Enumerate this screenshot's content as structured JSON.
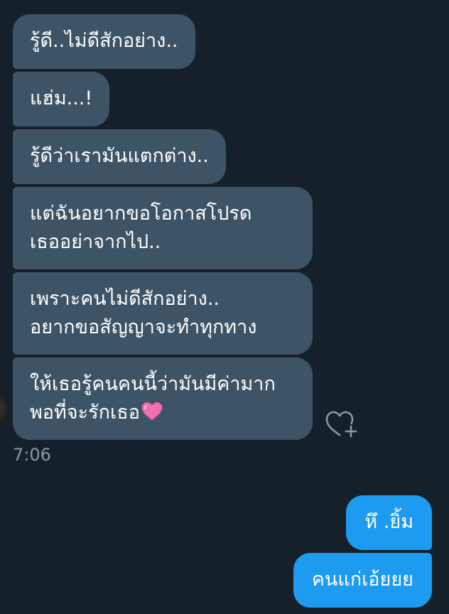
{
  "conversation": {
    "incoming_messages": [
      {
        "lines": [
          "รู้ดี..ไม่ดีสักอย่าง.."
        ]
      },
      {
        "lines": [
          "แฮ่ม...!"
        ]
      },
      {
        "lines": [
          "รู้ดีว่าเรามันแตกต่าง.."
        ]
      },
      {
        "lines": [
          "แต่ฉันอยากขอโอกาสโปรด",
          "เธออย่าจากไป.."
        ]
      },
      {
        "lines": [
          "เพราะคนไม่ดีสักอย่าง..",
          "อยากขอสัญญาจะทำทุกทาง"
        ]
      },
      {
        "lines": [
          "ให้เธอรู้คนคนนี้ว่ามันมีค่ามาก",
          "พอที่จะรักเธอ"
        ],
        "trailing_emoji": "pink-heart"
      }
    ],
    "timestamp": "7:06",
    "outgoing_messages": [
      {
        "lines": [
          "หึ .ยิ้ม"
        ]
      },
      {
        "lines": [
          "คนแก่เอ้ยยย"
        ]
      }
    ]
  },
  "icons": {
    "react": "heart-plus-icon",
    "emoji": "pink-heart-emoji"
  },
  "colors": {
    "background": "#15202b",
    "incoming_bubble": "#3d5466",
    "outgoing_bubble": "#1d9bf0",
    "text": "#ffffff",
    "timestamp": "#8b98a5",
    "emoji_heart": "#f06fae"
  }
}
